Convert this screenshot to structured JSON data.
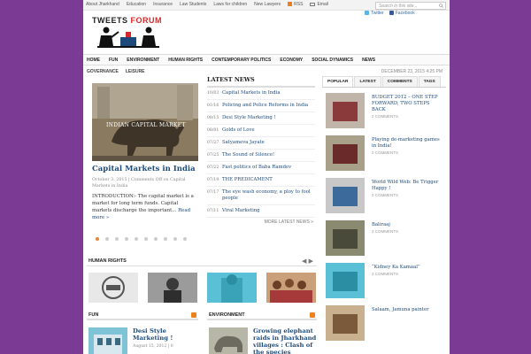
{
  "topbar": {
    "links": [
      "About Jharkhand",
      "Education",
      "Insurance",
      "Law Students",
      "Laws for children",
      "New Lawyers",
      "RSS",
      "Email"
    ],
    "search_placeholder": "Search in this site...",
    "social": [
      "Twitter",
      "Facebook"
    ]
  },
  "logo": {
    "part1": "TWEETS",
    "part2": "FORUM"
  },
  "nav": {
    "items": [
      "HOME",
      "FUN",
      "ENVIRONMENT",
      "HUMAN RIGHTS",
      "CONTEMPORARY POLITICS",
      "ECONOMY",
      "SOCIAL DYNAMICS",
      "NEWS"
    ],
    "subitems": [
      "GOVERNANCE",
      "LEISURE"
    ],
    "date": "DECEMBER 23, 2015 4:25 PM"
  },
  "slider": {
    "caption": "INDIAN CAPITAL MARKET",
    "title": "Capital Markets in India",
    "meta": "October 3, 2015  |  Comments Off on Capital Markets in India",
    "text": "INTRODUCTION:- The capital market is a market for long term funds. Capital markets discharge the important...",
    "read_more": "Read more »",
    "dot_count": 10,
    "active_dot": 0
  },
  "latest_news": {
    "heading": "LATEST NEWS",
    "items": [
      {
        "date": "10/03",
        "title": "Capital Markets in India"
      },
      {
        "date": "01/16",
        "title": "Policing and Police Reforms in India"
      },
      {
        "date": "08/15",
        "title": "Desi Style Marketing !"
      },
      {
        "date": "08/01",
        "title": "Golds of Love"
      },
      {
        "date": "07/27",
        "title": "Satyameva Jayate"
      },
      {
        "date": "07/25",
        "title": "The Sound of Silence!"
      },
      {
        "date": "07/22",
        "title": "Fast politics of Baba Ramdev"
      },
      {
        "date": "07/19",
        "title": "THE PREDICAMENT"
      },
      {
        "date": "07/17",
        "title": "The eye wash economy, a ploy to fool people"
      },
      {
        "date": "07/11",
        "title": "Viral Marketing"
      }
    ],
    "more": "MORE LATEST NEWS »"
  },
  "sidebar": {
    "tabs": [
      "POPULAR",
      "LATEST",
      "COMMENTS",
      "TAGS"
    ],
    "posts": [
      {
        "title": "BUDGET 2012 – ONE STEP FORWARD, TWO STEPS BACK",
        "comments": "2 COMMENTS"
      },
      {
        "title": "Playing de-marketing games in India!",
        "comments": "2 COMMENTS"
      },
      {
        "title": "World Wild Web: Be Trigger Happy !",
        "comments": "2 COMMENTS"
      },
      {
        "title": "Baliraaj",
        "comments": "2 COMMENTS"
      },
      {
        "title": "“Kidney Ka Kamaal”",
        "comments": "2 COMMENTS"
      },
      {
        "title": "Salaam, Jamuna painter",
        "comments": ""
      }
    ]
  },
  "human_rights": {
    "heading": "HUMAN RIGHTS",
    "arrows": "◀ ▶"
  },
  "fun": {
    "heading": "FUN",
    "post_title": "Desi Style Marketing !",
    "meta": "August 15, 2012  |  0"
  },
  "environment": {
    "heading": "ENVIRONMENT",
    "post_title": "Growing elephant raids in Jharkhand villages : Clash of the species"
  },
  "colors": {
    "background": "#7b3b94",
    "link": "#1d4a7a",
    "accent": "#d9272b",
    "rss": "#f07f1e"
  }
}
